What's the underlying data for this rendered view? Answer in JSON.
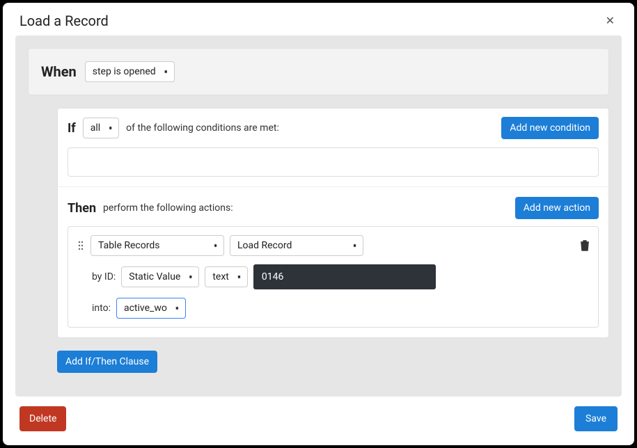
{
  "modal": {
    "title": "Load a Record"
  },
  "when": {
    "label": "When",
    "trigger": "step is opened"
  },
  "if": {
    "label": "If",
    "quantifier": "all",
    "text": "of the following conditions are met:",
    "add_button": "Add new condition"
  },
  "then": {
    "label": "Then",
    "text": "perform the following actions:",
    "add_button": "Add new action"
  },
  "action": {
    "category": "Table Records",
    "type": "Load Record",
    "by_id_label": "by ID:",
    "source": "Static Value",
    "datatype": "text",
    "value": "0146",
    "into_label": "into:",
    "target": "active_wo"
  },
  "add_clause": "Add If/Then Clause",
  "footer": {
    "delete": "Delete",
    "save": "Save"
  }
}
